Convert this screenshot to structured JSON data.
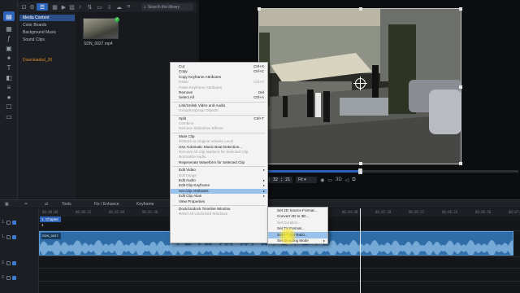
{
  "library": {
    "search_placeholder": "Search the library",
    "tree": [
      {
        "label": "Media Content",
        "active": true
      },
      {
        "label": "Color Boards"
      },
      {
        "label": "Background Music"
      },
      {
        "label": "Sound Clips"
      },
      {
        "label": "Downloaded_20",
        "download": true
      }
    ],
    "thumbnail_label": "SDN_0027.mp4"
  },
  "preview": {
    "timecode": "00 ; 32 ; 21",
    "fit_value": "Fit",
    "mode_3d": "3D",
    "progress": 0.39
  },
  "timeline_toolbar": {
    "tools": "Tools",
    "fix_enhance": "Fix / Enhance",
    "keyframe": "Keyframe"
  },
  "timeline": {
    "chapter": "1. Chapter 1",
    "ruler": [
      "00;00;00",
      "00;00;32",
      "00;01;04",
      "00;01;36",
      "00;02;08",
      "00;02;40",
      "00;03;12",
      "00;03;44",
      "00;04;16",
      "00;04;48",
      "00;05;20",
      "00;05;52",
      "00;06;24",
      "00;06;56",
      "00;07;28"
    ],
    "tracks": [
      "1.",
      "1.",
      "2.",
      "2."
    ],
    "clip_label": "SDN_0027"
  },
  "context_menu": [
    {
      "label": "Cut",
      "shortcut": "Ctrl+X"
    },
    {
      "label": "Copy",
      "shortcut": "Ctrl+C"
    },
    {
      "label": "Copy Keyframe Attributes"
    },
    {
      "label": "Paste",
      "shortcut": "Ctrl+V",
      "disabled": true
    },
    {
      "label": "Paste Keyframe Attributes",
      "disabled": true
    },
    {
      "label": "Remove",
      "shortcut": "Del"
    },
    {
      "label": "Select All",
      "shortcut": "Ctrl+A"
    },
    {
      "sep": true
    },
    {
      "label": "Link/Unlink Video and Audio"
    },
    {
      "label": "Group/Ungroup Objects",
      "disabled": true
    },
    {
      "sep": true
    },
    {
      "label": "Split",
      "shortcut": "Ctrl+T"
    },
    {
      "label": "Combine",
      "disabled": true
    },
    {
      "label": "Remove Slideshow Effects",
      "disabled": true
    },
    {
      "sep": true
    },
    {
      "label": "Mute Clip"
    },
    {
      "label": "Restore to Original Volume Level",
      "disabled": true
    },
    {
      "label": "Use Automatic Music Beat Detection..."
    },
    {
      "label": "Remove All Clip Markers for Selected Clip",
      "disabled": true
    },
    {
      "label": "Normalize Audio",
      "disabled": true
    },
    {
      "label": "Regenerate Waveform for Selected Clip"
    },
    {
      "sep": true
    },
    {
      "label": "Edit Video",
      "submenu": true
    },
    {
      "label": "Edit Image",
      "disabled": true
    },
    {
      "label": "Edit Audio",
      "submenu": true
    },
    {
      "label": "Edit Clip Keyframe",
      "submenu": true
    },
    {
      "label": "Set Clip Attributes",
      "submenu": true,
      "highlighted": true
    },
    {
      "label": "Edit Clip Alias",
      "submenu": true
    },
    {
      "label": "View Properties"
    },
    {
      "sep": true
    },
    {
      "label": "Dock/Undock Timeline Window"
    },
    {
      "label": "Reset All Undocked Windows",
      "disabled": true
    }
  ],
  "submenu": [
    {
      "label": "Set 2D Source Format..."
    },
    {
      "label": "Convert 2D to 3D..."
    },
    {
      "label": "Set Duration...",
      "disabled": true
    },
    {
      "label": "Set TV Format..."
    },
    {
      "label": "Set Aspect Ratio...",
      "highlighted": true
    },
    {
      "label": "Set Blending Mode",
      "submenu": true
    }
  ],
  "colors": {
    "accent": "#2d63b8",
    "menu_highlight": "#99c1ec",
    "cursor_highlight": "#ffee28"
  }
}
